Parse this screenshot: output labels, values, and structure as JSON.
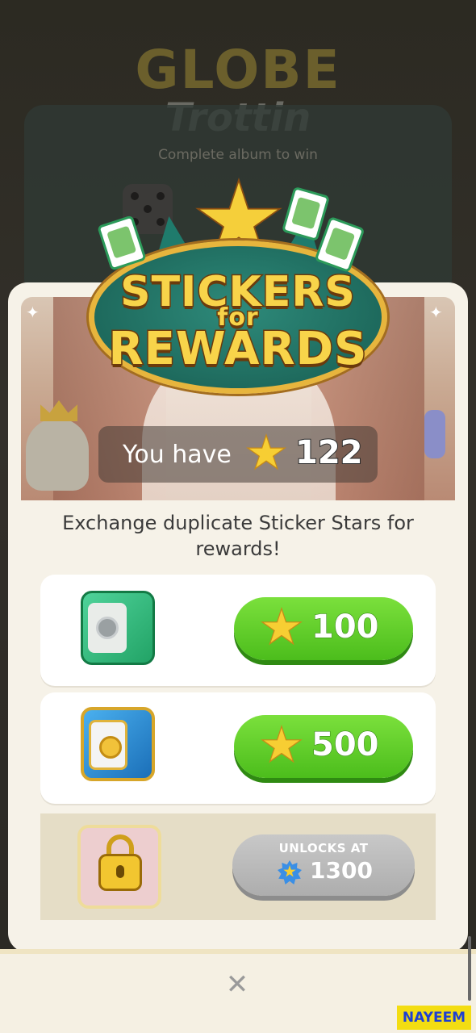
{
  "background": {
    "title_line1": "GLOBE",
    "title_line2": "Trottin",
    "subtitle": "Complete album to win"
  },
  "modal": {
    "title": {
      "line1": "STICKERS",
      "line2": "for",
      "line3": "REWARDS"
    },
    "balance": {
      "label": "You have",
      "icon": "star-icon",
      "value": "122"
    },
    "description": "Exchange duplicate Sticker Stars for rewards!",
    "rewards": [
      {
        "name": "green-vault",
        "icon": "green-vault-icon",
        "cost": "100",
        "state": "available"
      },
      {
        "name": "blue-vault",
        "icon": "blue-vault-icon",
        "cost": "500",
        "state": "available"
      },
      {
        "name": "pink-vault",
        "icon": "locked-vault-icon",
        "unlock_label": "UNLOCKS AT",
        "unlock_value": "1300",
        "state": "locked"
      }
    ],
    "close_label": "✕"
  },
  "watermark": "NAYEEM",
  "colors": {
    "accent_green": "#4cbd1c",
    "star_yellow": "#f7ce33",
    "panel_bg": "#f6f2e8",
    "locked_gray": "#adadad"
  }
}
